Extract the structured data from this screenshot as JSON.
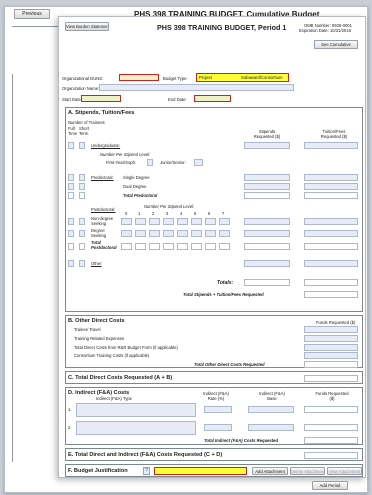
{
  "back": {
    "previous_label": "Previous",
    "title": "PHS 398 TRAINING BUDGET, Cumulative Budget"
  },
  "header": {
    "view_statement_label": "View Burden Statement",
    "title": "PHS 398 TRAINING BUDGET, Period 1",
    "omb_number": "OMB Number: 0925-0001",
    "expiration": "Expiration Date: 10/31/2018",
    "see_cumulative_label": "See Cumulative"
  },
  "org": {
    "duns_label": "Organizational DUNS:",
    "budget_type_label": "Budget Type:",
    "budget_type_options": [
      "Project",
      "Subaward/Consortium"
    ],
    "org_name_label": "Organization Name:",
    "start_date_label": "Start Date:",
    "end_date_label": "End Date:"
  },
  "sectionA": {
    "title": "A. Stipends, Tuition/Fees",
    "number_of_trainees": "Number of Trainees",
    "full_time": "Full Time",
    "short_term": "Short Term",
    "stipends_requested": "Stipends Requested ($)",
    "tuition_requested": "Tuition/Fees Requested ($)",
    "undergraduate": "Undergraduate:",
    "number_per_stipend_level": "Number Per Stipend Level:",
    "first_year_soph": "First-Year/Soph:",
    "junior_senior": "Junior/Senior:",
    "predoctoral": "Predoctoral:",
    "single_degree": "Single Degree",
    "dual_degree": "Dual Degree",
    "total_predoctoral": "Total Predoctoral",
    "postdoctoral": "Postdoctoral:",
    "levels": [
      "0",
      "1",
      "2",
      "3",
      "4",
      "5",
      "6",
      "7"
    ],
    "non_degree_seeking": "Non-degree Seeking",
    "degree_seeking": "Degree Seeking",
    "total_postdoctoral": "Total Postdoctoral",
    "other": "Other",
    "totals": "Totals:",
    "total_stipends": "Total Stipends + Tuition/Fees Requested"
  },
  "sectionB": {
    "title": "B. Other Direct Costs",
    "funds_requested": "Funds Requested ($)",
    "items": [
      "Trainee Travel",
      "Training Related Expenses",
      "Total Direct Costs from R&R Budget Form (if applicable)",
      "Consortium Training Costs (if applicable)"
    ],
    "total_label": "Total Other Direct Costs Requested"
  },
  "sectionC": {
    "title": "C. Total Direct Costs Requested (A + B)"
  },
  "sectionD": {
    "title": "D. Indirect (F&A) Costs",
    "type_header": "Indirect (F&A) Type",
    "rate_header": "Indirect (F&A) Rate (%)",
    "base_header": "Indirect (F&A) Base",
    "funds_header": "Funds Requested ($)",
    "rows": [
      "1.",
      "2."
    ],
    "total_label": "Total Indirect (F&A) Costs Requested"
  },
  "sectionE": {
    "title": "E. Total Direct and Indirect (F&A) Costs Requested (C + D)"
  },
  "sectionF": {
    "title": "F. Budget Justification",
    "help": "?",
    "add_attachment": "Add Attachment",
    "delete_attachment": "Delete Attachment",
    "view_attachment": "View Attachment"
  },
  "footer": {
    "add_period": "Add Period"
  },
  "colors": {
    "field": "#e6ebf6",
    "required_border": "#cc2222",
    "highlight": "#ffff33",
    "background": "#c9ced6"
  }
}
